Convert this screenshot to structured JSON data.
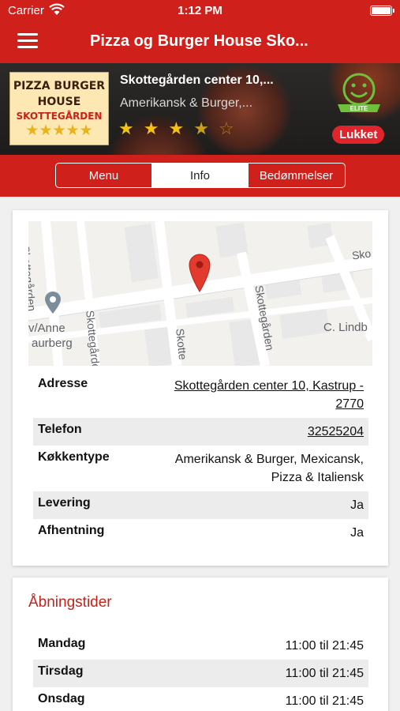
{
  "statusbar": {
    "carrier": "Carrier",
    "time": "1:12 PM"
  },
  "nav": {
    "title": "Pizza og Burger House Sko...",
    "menu_icon": "hamburger-menu-icon"
  },
  "restaurant": {
    "logo_line1": "PIZZA BURGER",
    "logo_line2": "HOUSE",
    "logo_line3": "SKOTTEGÅRDEN",
    "logo_stars": "★★★★★",
    "name": "Skottegården center 10,...",
    "cuisine": "Amerikansk & Burger,...",
    "rating": 3.5,
    "rating_max": 5,
    "elite_badge_text": "ELITE",
    "open_status": "Lukket"
  },
  "tabs": [
    {
      "label": "Menu",
      "active": false
    },
    {
      "label": "Info",
      "active": true
    },
    {
      "label": "Bedømmelser",
      "active": false
    }
  ],
  "map": {
    "labels": [
      "Skottegården",
      "Skottegården",
      "Skotte",
      "Skottegården",
      "Sko",
      "v/Anne",
      "aurberg",
      "C. Lindb"
    ],
    "pin_icon": "map-pin-icon",
    "poi_icon": "poi-pin-icon"
  },
  "info": [
    {
      "key": "Adresse",
      "value": "Skottegården center 10, Kastrup - 2770",
      "link": true
    },
    {
      "key": "Telefon",
      "value": "32525204",
      "link": true
    },
    {
      "key": "Køkkentype",
      "value": "Amerikansk & Burger, Mexicansk, Pizza & Italiensk",
      "link": false
    },
    {
      "key": "Levering",
      "value": "Ja",
      "link": false
    },
    {
      "key": "Afhentning",
      "value": "Ja",
      "link": false
    }
  ],
  "hours": {
    "title": "Åbningstider",
    "days": [
      {
        "day": "Mandag",
        "time": "11:00 til 21:45"
      },
      {
        "day": "Tirsdag",
        "time": "11:00 til 21:45"
      },
      {
        "day": "Onsdag",
        "time": "11:00 til 21:45"
      }
    ]
  },
  "colors": {
    "brand_red": "#d0201b",
    "closed_red": "#e0242b",
    "star_yellow": "#f2c21b",
    "heading_red": "#c5231a"
  }
}
